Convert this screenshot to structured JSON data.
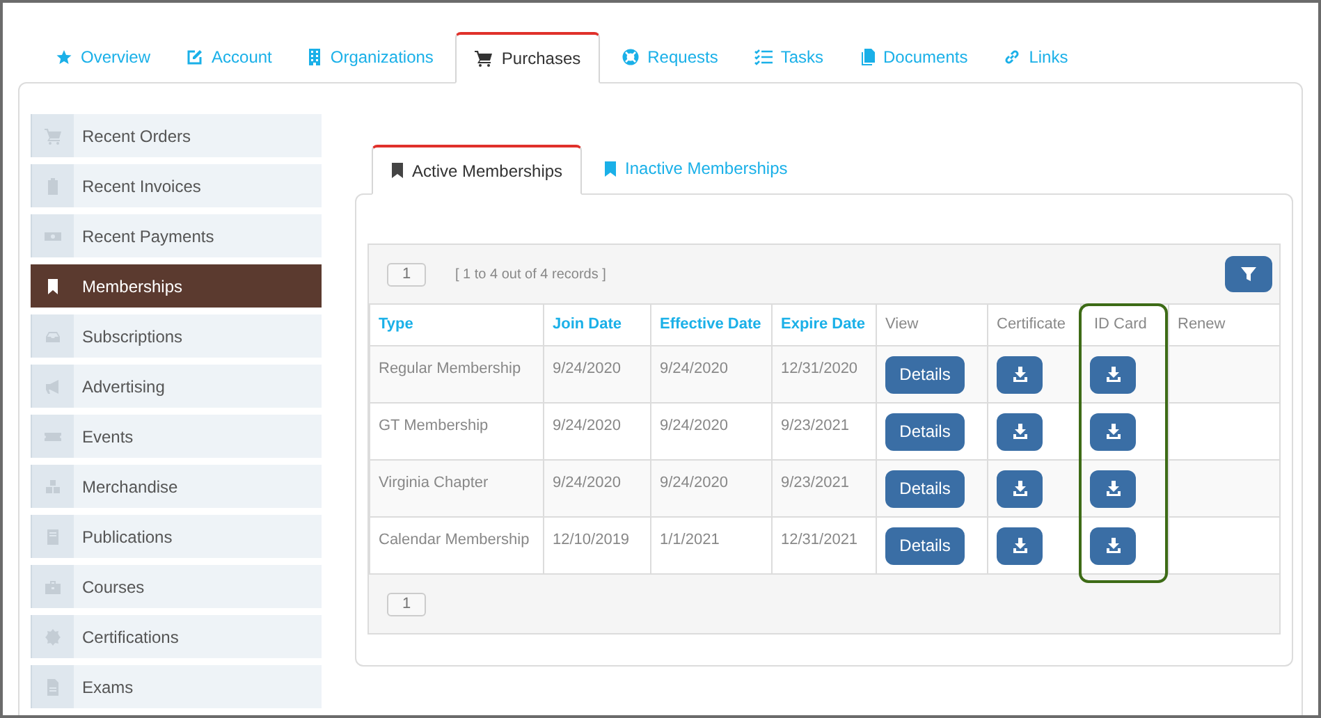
{
  "tabs": [
    {
      "label": "Overview",
      "selected": false
    },
    {
      "label": "Account",
      "selected": false
    },
    {
      "label": "Organizations",
      "selected": false
    },
    {
      "label": "Purchases",
      "selected": true
    },
    {
      "label": "Requests",
      "selected": false
    },
    {
      "label": "Tasks",
      "selected": false
    },
    {
      "label": "Documents",
      "selected": false
    },
    {
      "label": "Links",
      "selected": false
    }
  ],
  "sidebar": {
    "items": [
      {
        "label": "Recent Orders",
        "selected": false
      },
      {
        "label": "Recent Invoices",
        "selected": false
      },
      {
        "label": "Recent Payments",
        "selected": false
      },
      {
        "label": "Memberships",
        "selected": true
      },
      {
        "label": "Subscriptions",
        "selected": false
      },
      {
        "label": "Advertising",
        "selected": false
      },
      {
        "label": "Events",
        "selected": false
      },
      {
        "label": "Merchandise",
        "selected": false
      },
      {
        "label": "Publications",
        "selected": false
      },
      {
        "label": "Courses",
        "selected": false
      },
      {
        "label": "Certifications",
        "selected": false
      },
      {
        "label": "Exams",
        "selected": false
      }
    ]
  },
  "subtabs": [
    {
      "label": "Active Memberships",
      "selected": true
    },
    {
      "label": "Inactive Memberships",
      "selected": false
    }
  ],
  "table": {
    "page": "1",
    "records": "[ 1 to 4 out of 4 records ]",
    "footer_page": "1",
    "columns": [
      {
        "label": "Type",
        "sortable": true,
        "highlighted": false
      },
      {
        "label": "Join Date",
        "sortable": true,
        "highlighted": false
      },
      {
        "label": "Effective Date",
        "sortable": true,
        "highlighted": false
      },
      {
        "label": "Expire Date",
        "sortable": true,
        "highlighted": false
      },
      {
        "label": "View",
        "sortable": false,
        "highlighted": false
      },
      {
        "label": "Certificate",
        "sortable": false,
        "highlighted": false
      },
      {
        "label": "ID Card",
        "sortable": false,
        "highlighted": true
      },
      {
        "label": "Renew",
        "sortable": false,
        "highlighted": false
      }
    ],
    "rows": [
      {
        "type": "Regular Membership",
        "join_date": "9/24/2020",
        "effective_date": "9/24/2020",
        "expire_date": "12/31/2020",
        "view": "Details"
      },
      {
        "type": "GT Membership",
        "join_date": "9/24/2020",
        "effective_date": "9/24/2020",
        "expire_date": "9/23/2021",
        "view": "Details"
      },
      {
        "type": "Virginia Chapter",
        "join_date": "9/24/2020",
        "effective_date": "9/24/2020",
        "expire_date": "9/23/2021",
        "view": "Details"
      },
      {
        "type": "Calendar Membership",
        "join_date": "12/10/2019",
        "effective_date": "1/1/2021",
        "expire_date": "12/31/2021",
        "view": "Details"
      }
    ]
  }
}
